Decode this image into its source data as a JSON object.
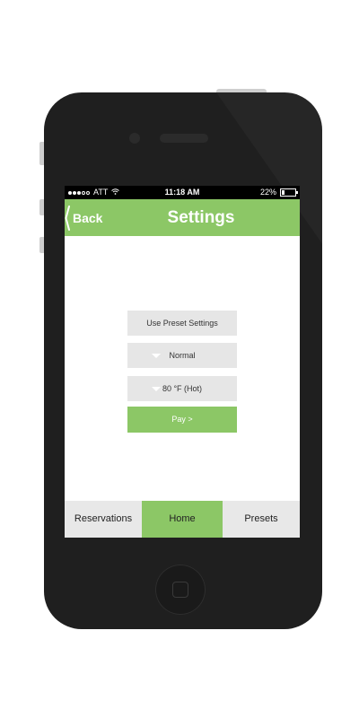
{
  "status_bar": {
    "carrier": "ATT",
    "time": "11:18 AM",
    "battery": "22%"
  },
  "nav": {
    "back_label": "Back",
    "title": "Settings"
  },
  "controls": {
    "preset_button": "Use Preset Settings",
    "mode_dropdown": "Normal",
    "temperature_dropdown": "80 °F (Hot)",
    "pay_button": "Pay >"
  },
  "tabs": [
    {
      "label": "Reservations"
    },
    {
      "label": "Home",
      "active": true
    },
    {
      "label": "Presets"
    }
  ],
  "colors": {
    "accent": "#8cc766",
    "button_bg": "#e6e6e6",
    "phone_body": "#1f1f1f"
  },
  "icons": {
    "status_signal": "signal-dots-icon",
    "status_wifi": "wifi-icon",
    "status_battery": "battery-icon",
    "back": "chevron-left-icon",
    "dropdown": "triangle-down-icon"
  }
}
